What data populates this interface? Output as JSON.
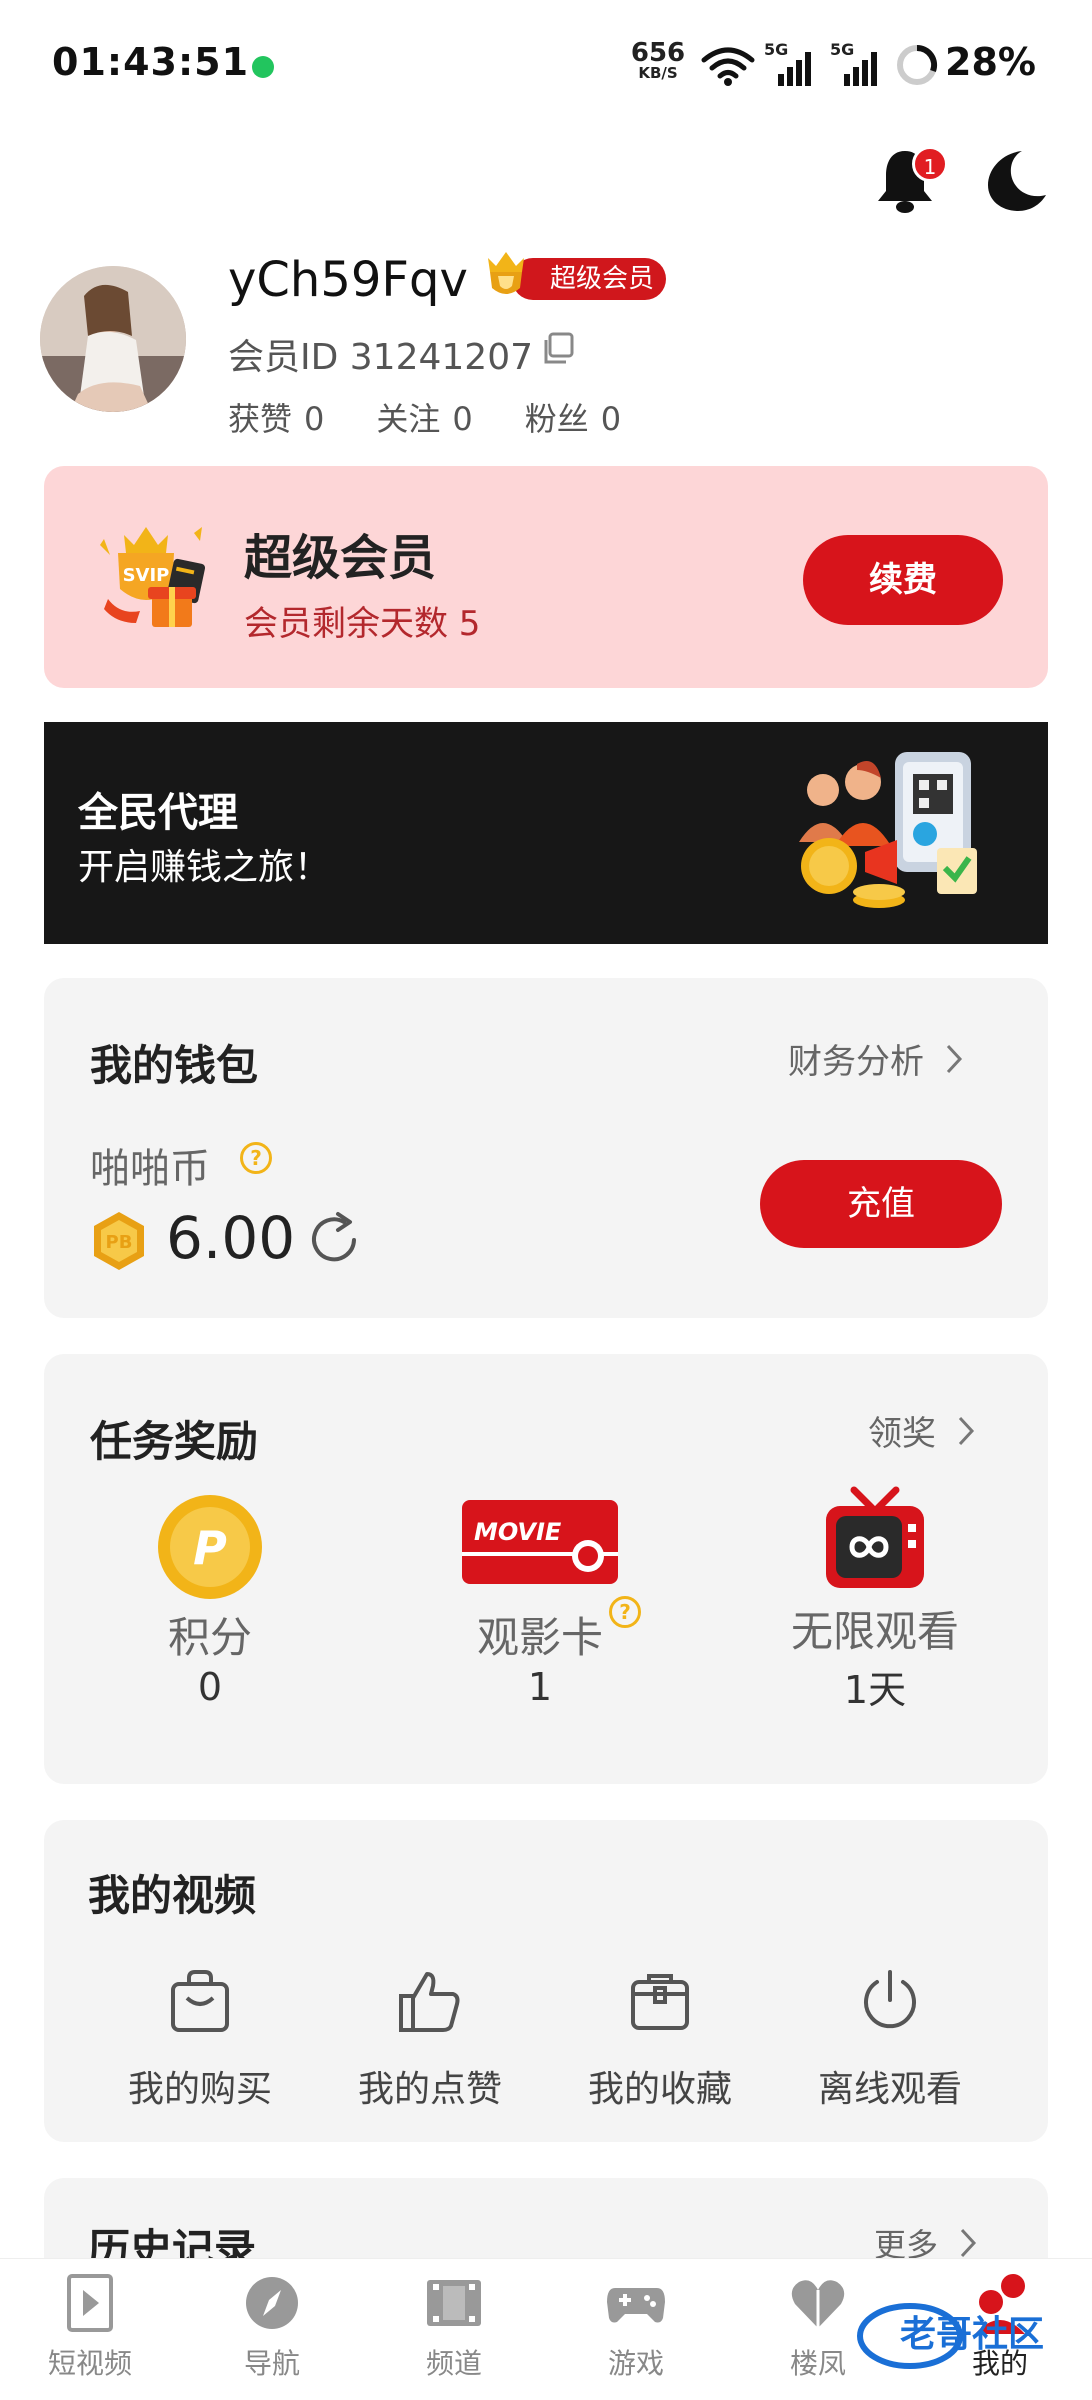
{
  "status_bar": {
    "time": "01:43:51",
    "net_speed": "656",
    "net_speed_unit": "KB/S",
    "network_1": "5G",
    "network_2": "5G",
    "battery": "28%"
  },
  "header": {
    "notification_count": "1"
  },
  "profile": {
    "username": "yCh59Fqv",
    "vip_badge": "超级会员",
    "member_id": "会员ID 31241207",
    "stats": [
      {
        "label": "获赞",
        "value": "0"
      },
      {
        "label": "关注",
        "value": "0"
      },
      {
        "label": "粉丝",
        "value": "0"
      }
    ]
  },
  "vip_card": {
    "title": "超级会员",
    "days_left": "会员剩余天数 5",
    "renew_label": "续费"
  },
  "agent_banner": {
    "title": "全民代理",
    "subtitle": "开启赚钱之旅！"
  },
  "wallet": {
    "title": "我的钱包",
    "link": "财务分析",
    "coin_label": "啪啪币",
    "coin_value": "6.00",
    "recharge_label": "充值"
  },
  "tasks": {
    "title": "任务奖励",
    "link": "领奖",
    "items": [
      {
        "label": "积分",
        "value": "0"
      },
      {
        "label": "观影卡",
        "value": "1",
        "movie_text": "MOVIE"
      },
      {
        "label": "无限观看",
        "value": "1天"
      }
    ]
  },
  "videos": {
    "title": "我的视频",
    "items": [
      {
        "label": "我的购买"
      },
      {
        "label": "我的点赞"
      },
      {
        "label": "我的收藏"
      },
      {
        "label": "离线观看"
      }
    ]
  },
  "history": {
    "title": "历史记录",
    "link": "更多"
  },
  "bottom_nav": {
    "items": [
      {
        "label": "短视频"
      },
      {
        "label": "导航"
      },
      {
        "label": "频道"
      },
      {
        "label": "游戏"
      },
      {
        "label": "楼凤"
      },
      {
        "label": "我的"
      }
    ],
    "watermark": "老哥社区",
    "active_color": "#d7141b"
  },
  "colors": {
    "accent": "#d7141b",
    "vip_card_bg": "#fdd6d7",
    "card_bg": "#f4f4f4",
    "banner_bg": "#171717",
    "gold": "#f2b418"
  }
}
